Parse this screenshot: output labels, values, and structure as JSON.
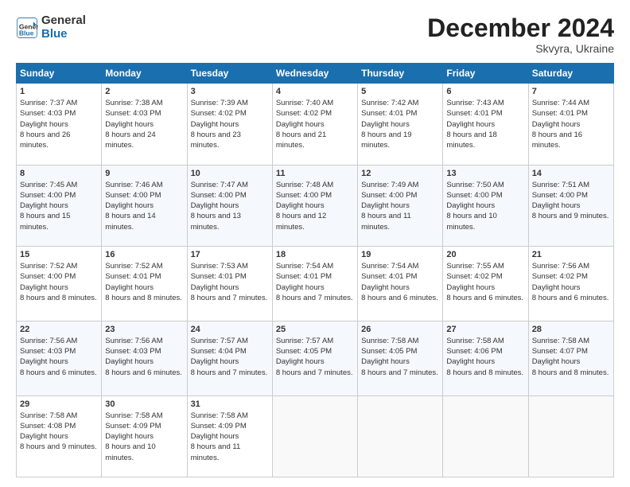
{
  "header": {
    "logo_line1": "General",
    "logo_line2": "Blue",
    "month": "December 2024",
    "location": "Skvyra, Ukraine"
  },
  "weekdays": [
    "Sunday",
    "Monday",
    "Tuesday",
    "Wednesday",
    "Thursday",
    "Friday",
    "Saturday"
  ],
  "weeks": [
    [
      {
        "day": "1",
        "sunrise": "7:37 AM",
        "sunset": "4:03 PM",
        "daylight": "8 hours and 26 minutes."
      },
      {
        "day": "2",
        "sunrise": "7:38 AM",
        "sunset": "4:03 PM",
        "daylight": "8 hours and 24 minutes."
      },
      {
        "day": "3",
        "sunrise": "7:39 AM",
        "sunset": "4:02 PM",
        "daylight": "8 hours and 23 minutes."
      },
      {
        "day": "4",
        "sunrise": "7:40 AM",
        "sunset": "4:02 PM",
        "daylight": "8 hours and 21 minutes."
      },
      {
        "day": "5",
        "sunrise": "7:42 AM",
        "sunset": "4:01 PM",
        "daylight": "8 hours and 19 minutes."
      },
      {
        "day": "6",
        "sunrise": "7:43 AM",
        "sunset": "4:01 PM",
        "daylight": "8 hours and 18 minutes."
      },
      {
        "day": "7",
        "sunrise": "7:44 AM",
        "sunset": "4:01 PM",
        "daylight": "8 hours and 16 minutes."
      }
    ],
    [
      {
        "day": "8",
        "sunrise": "7:45 AM",
        "sunset": "4:00 PM",
        "daylight": "8 hours and 15 minutes."
      },
      {
        "day": "9",
        "sunrise": "7:46 AM",
        "sunset": "4:00 PM",
        "daylight": "8 hours and 14 minutes."
      },
      {
        "day": "10",
        "sunrise": "7:47 AM",
        "sunset": "4:00 PM",
        "daylight": "8 hours and 13 minutes."
      },
      {
        "day": "11",
        "sunrise": "7:48 AM",
        "sunset": "4:00 PM",
        "daylight": "8 hours and 12 minutes."
      },
      {
        "day": "12",
        "sunrise": "7:49 AM",
        "sunset": "4:00 PM",
        "daylight": "8 hours and 11 minutes."
      },
      {
        "day": "13",
        "sunrise": "7:50 AM",
        "sunset": "4:00 PM",
        "daylight": "8 hours and 10 minutes."
      },
      {
        "day": "14",
        "sunrise": "7:51 AM",
        "sunset": "4:00 PM",
        "daylight": "8 hours and 9 minutes."
      }
    ],
    [
      {
        "day": "15",
        "sunrise": "7:52 AM",
        "sunset": "4:00 PM",
        "daylight": "8 hours and 8 minutes."
      },
      {
        "day": "16",
        "sunrise": "7:52 AM",
        "sunset": "4:01 PM",
        "daylight": "8 hours and 8 minutes."
      },
      {
        "day": "17",
        "sunrise": "7:53 AM",
        "sunset": "4:01 PM",
        "daylight": "8 hours and 7 minutes."
      },
      {
        "day": "18",
        "sunrise": "7:54 AM",
        "sunset": "4:01 PM",
        "daylight": "8 hours and 7 minutes."
      },
      {
        "day": "19",
        "sunrise": "7:54 AM",
        "sunset": "4:01 PM",
        "daylight": "8 hours and 6 minutes."
      },
      {
        "day": "20",
        "sunrise": "7:55 AM",
        "sunset": "4:02 PM",
        "daylight": "8 hours and 6 minutes."
      },
      {
        "day": "21",
        "sunrise": "7:56 AM",
        "sunset": "4:02 PM",
        "daylight": "8 hours and 6 minutes."
      }
    ],
    [
      {
        "day": "22",
        "sunrise": "7:56 AM",
        "sunset": "4:03 PM",
        "daylight": "8 hours and 6 minutes."
      },
      {
        "day": "23",
        "sunrise": "7:56 AM",
        "sunset": "4:03 PM",
        "daylight": "8 hours and 6 minutes."
      },
      {
        "day": "24",
        "sunrise": "7:57 AM",
        "sunset": "4:04 PM",
        "daylight": "8 hours and 7 minutes."
      },
      {
        "day": "25",
        "sunrise": "7:57 AM",
        "sunset": "4:05 PM",
        "daylight": "8 hours and 7 minutes."
      },
      {
        "day": "26",
        "sunrise": "7:58 AM",
        "sunset": "4:05 PM",
        "daylight": "8 hours and 7 minutes."
      },
      {
        "day": "27",
        "sunrise": "7:58 AM",
        "sunset": "4:06 PM",
        "daylight": "8 hours and 8 minutes."
      },
      {
        "day": "28",
        "sunrise": "7:58 AM",
        "sunset": "4:07 PM",
        "daylight": "8 hours and 8 minutes."
      }
    ],
    [
      {
        "day": "29",
        "sunrise": "7:58 AM",
        "sunset": "4:08 PM",
        "daylight": "8 hours and 9 minutes."
      },
      {
        "day": "30",
        "sunrise": "7:58 AM",
        "sunset": "4:09 PM",
        "daylight": "8 hours and 10 minutes."
      },
      {
        "day": "31",
        "sunrise": "7:58 AM",
        "sunset": "4:09 PM",
        "daylight": "8 hours and 11 minutes."
      },
      null,
      null,
      null,
      null
    ]
  ]
}
